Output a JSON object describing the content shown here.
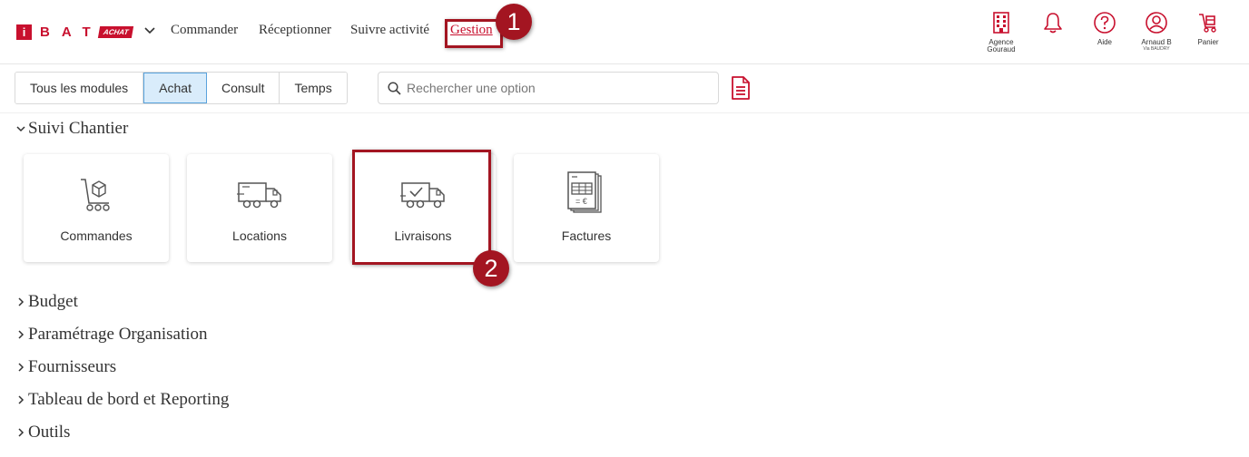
{
  "brand": {
    "mark": "i",
    "letters": "BAT",
    "badge": "ACHAT",
    "accent": "#c8102e"
  },
  "nav": {
    "items": [
      "Commander",
      "Réceptionner",
      "Suivre activité",
      "Gestion"
    ]
  },
  "annotations": {
    "step1": "1",
    "step2": "2",
    "highlight_color": "#a31521"
  },
  "header_icons": [
    {
      "icon": "building-icon",
      "label": "Agence",
      "label2": "Gouraud"
    },
    {
      "icon": "bell-icon",
      "label": ""
    },
    {
      "icon": "help-icon",
      "label": "Aide"
    },
    {
      "icon": "user-icon",
      "label": "Arnaud B",
      "sub": "Via BAUDRY"
    },
    {
      "icon": "cart-icon",
      "label": "Panier"
    }
  ],
  "modules": {
    "tabs": [
      "Tous les modules",
      "Achat",
      "Consult",
      "Temps"
    ],
    "active": "Achat"
  },
  "search": {
    "placeholder": "Rechercher une option"
  },
  "sections": [
    {
      "title": "Suivi Chantier",
      "expanded": true
    },
    {
      "title": "Budget",
      "expanded": false
    },
    {
      "title": "Paramétrage Organisation",
      "expanded": false
    },
    {
      "title": "Fournisseurs",
      "expanded": false
    },
    {
      "title": "Tableau de bord et Reporting",
      "expanded": false
    },
    {
      "title": "Outils",
      "expanded": false
    }
  ],
  "cards": [
    {
      "label": "Commandes",
      "icon": "trolley-box-icon"
    },
    {
      "label": "Locations",
      "icon": "truck-icon"
    },
    {
      "label": "Livraisons",
      "icon": "truck-check-icon"
    },
    {
      "label": "Factures",
      "icon": "invoice-icon"
    }
  ]
}
